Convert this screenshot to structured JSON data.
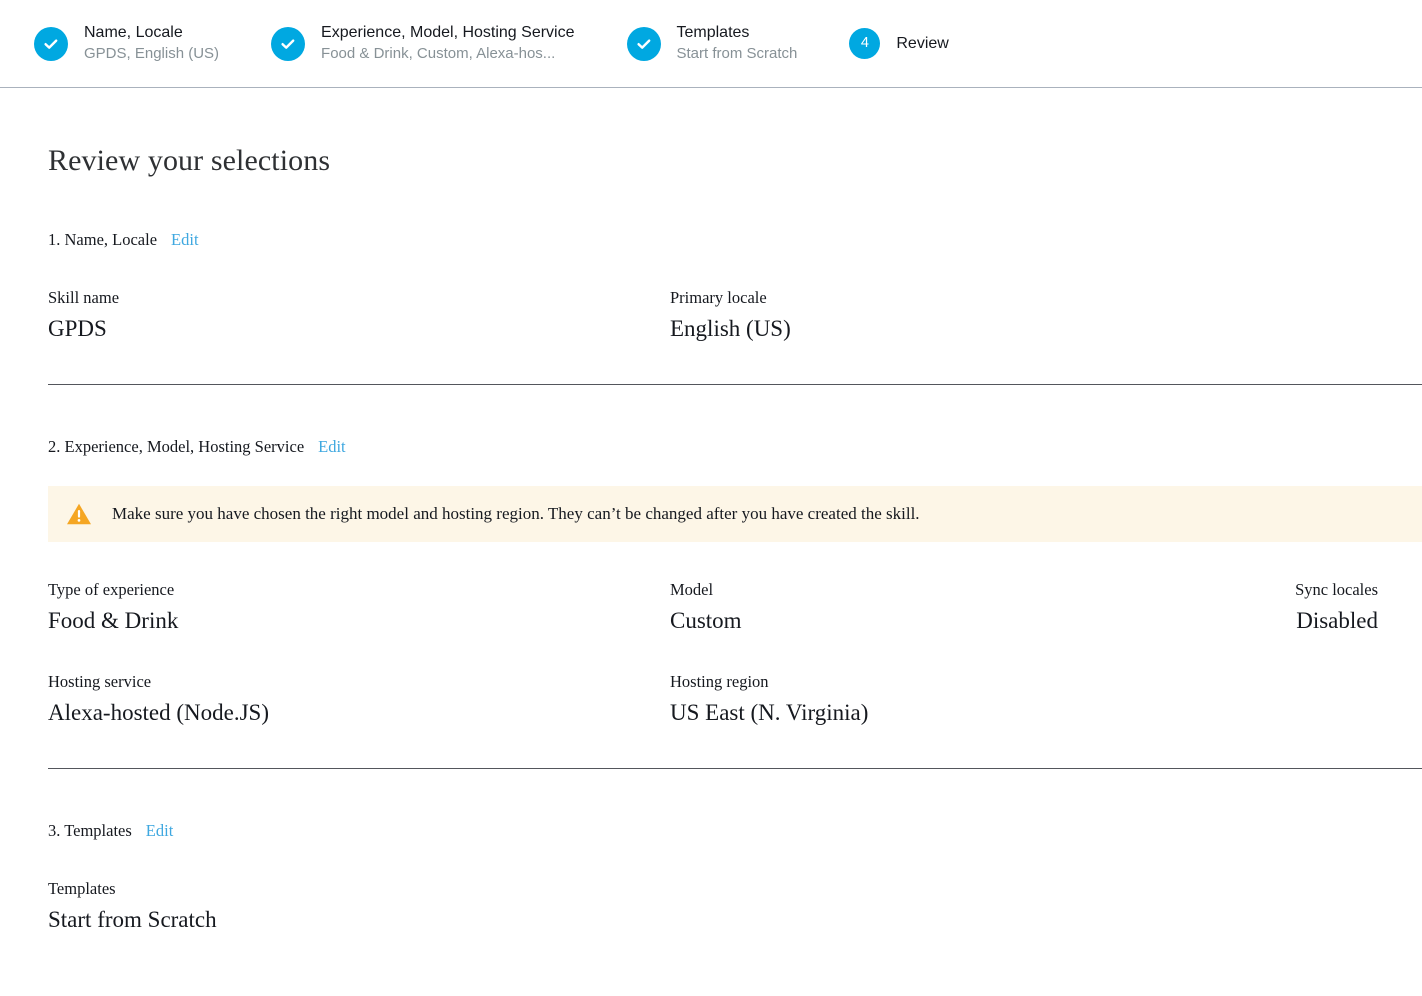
{
  "stepper": {
    "steps": [
      {
        "title": "Name, Locale",
        "subtitle": "GPDS, English (US)",
        "state": "complete",
        "icon": "check-icon",
        "badge": ""
      },
      {
        "title": "Experience, Model, Hosting Service",
        "subtitle": "Food & Drink, Custom, Alexa-hos...",
        "state": "complete",
        "icon": "check-icon",
        "badge": ""
      },
      {
        "title": "Templates",
        "subtitle": "Start from Scratch",
        "state": "complete",
        "icon": "check-icon",
        "badge": ""
      },
      {
        "title": "Review",
        "subtitle": "",
        "state": "current",
        "icon": "",
        "badge": "4"
      }
    ]
  },
  "page": {
    "title": "Review your selections"
  },
  "sections": [
    {
      "heading": "1. Name, Locale",
      "edit_label": "Edit",
      "rows": [
        [
          {
            "label": "Skill name",
            "value": "GPDS"
          },
          {
            "label": "Primary locale",
            "value": "English (US)"
          }
        ]
      ]
    },
    {
      "heading": "2. Experience, Model, Hosting Service",
      "edit_label": "Edit",
      "warning": {
        "icon": "warning-triangle-icon",
        "text": "Make sure you have chosen the right model and hosting region. They can’t be changed after you have created the skill."
      },
      "rows": [
        [
          {
            "label": "Type of experience",
            "value": "Food & Drink"
          },
          {
            "label": "Model",
            "value": "Custom"
          },
          {
            "label": "Sync locales",
            "value": "Disabled"
          }
        ],
        [
          {
            "label": "Hosting service",
            "value": "Alexa-hosted (Node.JS)"
          },
          {
            "label": "Hosting region",
            "value": "US East (N. Virginia)"
          }
        ]
      ]
    },
    {
      "heading": "3. Templates",
      "edit_label": "Edit",
      "rows": [
        [
          {
            "label": "Templates",
            "value": "Start from Scratch"
          }
        ]
      ]
    }
  ],
  "colors": {
    "accent": "#00a8e1",
    "link": "#3fa8e0",
    "warning_bg": "#fdf6e7",
    "warning_icon": "#f5a623",
    "divider": "#53565c",
    "header_border": "#aab2bd",
    "text": "#16191f",
    "muted": "#879196"
  }
}
